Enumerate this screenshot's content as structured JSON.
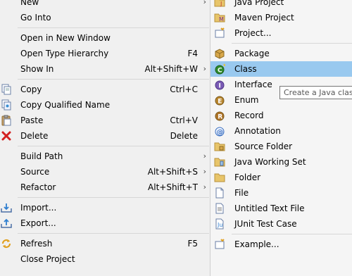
{
  "context_menu": {
    "items": [
      {
        "label": "New",
        "shortcut": "",
        "submenu": true,
        "icon": ""
      },
      {
        "label": "Go Into",
        "shortcut": "",
        "submenu": false,
        "icon": ""
      },
      {
        "separator": true
      },
      {
        "label": "Open in New Window",
        "shortcut": "",
        "submenu": false,
        "icon": ""
      },
      {
        "label": "Open Type Hierarchy",
        "shortcut": "F4",
        "submenu": false,
        "icon": ""
      },
      {
        "label": "Show In",
        "shortcut": "Alt+Shift+W",
        "submenu": true,
        "icon": ""
      },
      {
        "separator": true
      },
      {
        "label": "Copy",
        "shortcut": "Ctrl+C",
        "submenu": false,
        "icon": "copy-icon"
      },
      {
        "label": "Copy Qualified Name",
        "shortcut": "",
        "submenu": false,
        "icon": "copy-qualified-name-icon"
      },
      {
        "label": "Paste",
        "shortcut": "Ctrl+V",
        "submenu": false,
        "icon": "paste-icon"
      },
      {
        "label": "Delete",
        "shortcut": "Delete",
        "submenu": false,
        "icon": "delete-icon"
      },
      {
        "separator": true
      },
      {
        "label": "Build Path",
        "shortcut": "",
        "submenu": true,
        "icon": ""
      },
      {
        "label": "Source",
        "shortcut": "Alt+Shift+S",
        "submenu": true,
        "icon": ""
      },
      {
        "label": "Refactor",
        "shortcut": "Alt+Shift+T",
        "submenu": true,
        "icon": ""
      },
      {
        "separator": true
      },
      {
        "label": "Import...",
        "shortcut": "",
        "submenu": false,
        "icon": "import-icon"
      },
      {
        "label": "Export...",
        "shortcut": "",
        "submenu": false,
        "icon": "export-icon"
      },
      {
        "separator": true
      },
      {
        "label": "Refresh",
        "shortcut": "F5",
        "submenu": false,
        "icon": "refresh-icon"
      },
      {
        "label": "Close Project",
        "shortcut": "",
        "submenu": false,
        "icon": ""
      }
    ]
  },
  "new_submenu": {
    "items": [
      {
        "label": "Java Project",
        "icon": "java-project-icon"
      },
      {
        "label": "Maven Project",
        "icon": "maven-project-icon"
      },
      {
        "label": "Project...",
        "icon": "project-icon"
      },
      {
        "separator": true
      },
      {
        "label": "Package",
        "icon": "package-icon"
      },
      {
        "label": "Class",
        "icon": "class-icon",
        "selected": true
      },
      {
        "label": "Interface",
        "icon": "interface-icon"
      },
      {
        "label": "Enum",
        "icon": "enum-icon"
      },
      {
        "label": "Record",
        "icon": "record-icon"
      },
      {
        "label": "Annotation",
        "icon": "annotation-icon"
      },
      {
        "label": "Source Folder",
        "icon": "source-folder-icon"
      },
      {
        "label": "Java Working Set",
        "icon": "java-working-set-icon"
      },
      {
        "label": "Folder",
        "icon": "folder-icon"
      },
      {
        "label": "File",
        "icon": "file-icon"
      },
      {
        "label": "Untitled Text File",
        "icon": "untitled-text-file-icon"
      },
      {
        "label": "JUnit Test Case",
        "icon": "junit-test-case-icon"
      },
      {
        "separator": true
      },
      {
        "label": "Example...",
        "icon": "example-icon"
      }
    ]
  },
  "tooltip": {
    "text": "Create a Java class"
  },
  "colors": {
    "selection": "#99c9ef",
    "menu_bg": "#f0f0f0",
    "class_icon": "#2e8b2e",
    "delete_icon": "#d32020"
  }
}
